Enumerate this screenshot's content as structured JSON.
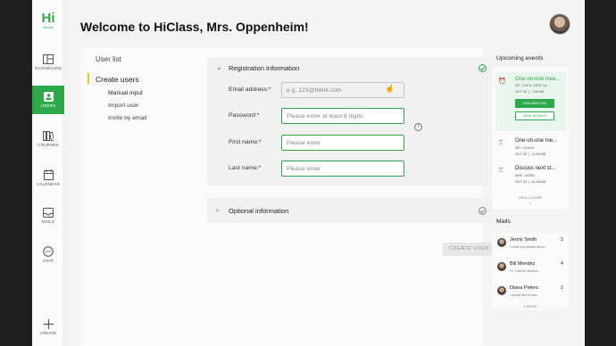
{
  "app": {
    "logo_text": "Hi",
    "logo_sub": "HiLink"
  },
  "nav": [
    {
      "label": "DASHBOARD",
      "icon": "dashboard-icon"
    },
    {
      "label": "USERS",
      "icon": "users-icon",
      "active": true
    },
    {
      "label": "COURSES",
      "icon": "courses-icon"
    },
    {
      "label": "CALENDAR",
      "icon": "calendar-icon"
    },
    {
      "label": "MAILS",
      "icon": "mails-icon"
    },
    {
      "label": "CHAT",
      "icon": "chat-icon"
    },
    {
      "label": "CREATE",
      "icon": "plus-icon"
    }
  ],
  "header": {
    "welcome": "Welcome to HiClass, Mrs. Oppenheim!"
  },
  "left_nav": {
    "user_list": "User list",
    "create_users": "Create users",
    "sub": [
      "Manual input",
      "Import user",
      "Invite by email"
    ]
  },
  "registration": {
    "title": "Registration information",
    "email_label": "Email address:*",
    "email_placeholder": "e.g. 123@hilink.com",
    "password_label": "Password:*",
    "password_placeholder": "Please enter at least 8 digits.",
    "first_label": "First name:*",
    "first_placeholder": "Please enter",
    "last_label": "Last name:*",
    "last_placeholder": "Please enter",
    "help": "?"
  },
  "optional": {
    "title": "Optional information"
  },
  "create_button": "CREATE USER",
  "events_panel": {
    "title": "Upcoming events",
    "events": [
      {
        "title": "One-on-one mee...",
        "sub": "MS. CHEN, MRS SA...",
        "date": "OCT 30",
        "time": "7:00 AM"
      },
      {
        "title": "One-on-one me...",
        "sub": "MR. CHANG",
        "date": "OCT 30",
        "time": "11:00 AM"
      },
      {
        "title": "Discuss next st...",
        "sub": "MRS. WEBB",
        "date": "OCT 31",
        "time": "11:00 AM"
      }
    ],
    "join_label": "JOIN MEETING",
    "view_label": "VIEW DETAILS",
    "more": "VIEW 3 MORE"
  },
  "mails_panel": {
    "title": "Mails",
    "mails": [
      {
        "name": "Jenny Smith",
        "preview": "Could you please send...",
        "count": "2"
      },
      {
        "name": "Bill Mendez",
        "preview": "Hi, I will be absent...",
        "count": "4"
      },
      {
        "name": "Diana Peters",
        "preview": "I would like to talk...",
        "count": "2"
      }
    ],
    "more": "4 MORE"
  },
  "colors": {
    "accent": "#2aa84a",
    "highlight": "#f2c418"
  }
}
